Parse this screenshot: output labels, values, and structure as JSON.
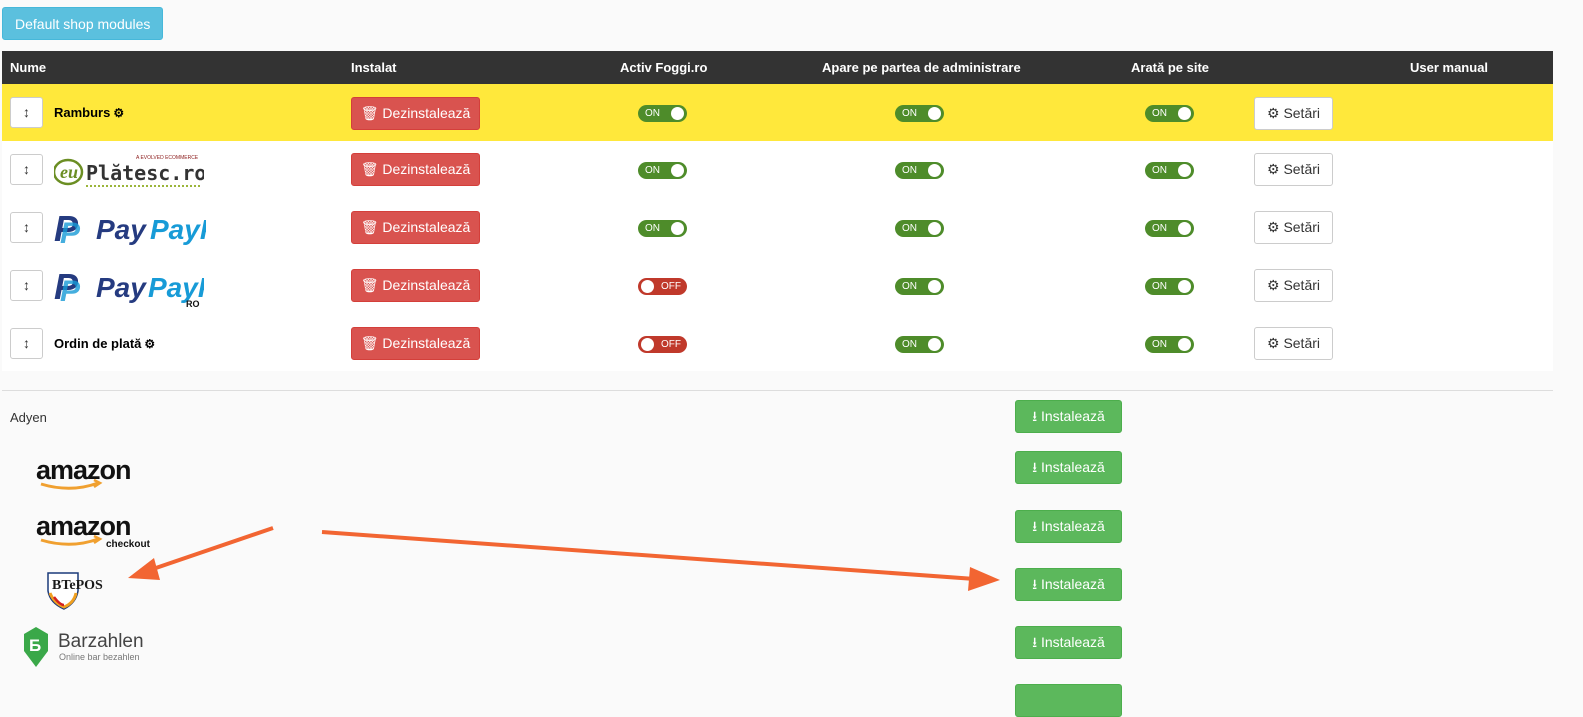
{
  "top_button": "Default shop modules",
  "headers": {
    "name": "Nume",
    "installed": "Instalat",
    "active": "Activ Foggi.ro",
    "admin": "Apare pe partea de administrare",
    "site": "Arată pe site",
    "manual": "User manual"
  },
  "installed_modules": [
    {
      "name": "Ramburs",
      "logo": "",
      "active": "ON",
      "admin": "ON",
      "site": "ON",
      "highlight": true
    },
    {
      "name": "",
      "logo": "euPlătesc.ro",
      "logo_tagline": "A EVOLVED ECOMMERCE",
      "active": "ON",
      "admin": "ON",
      "site": "ON"
    },
    {
      "name": "",
      "logo": "PayPal",
      "active": "ON",
      "admin": "ON",
      "site": "ON"
    },
    {
      "name": "",
      "logo": "PayPal",
      "logo_suffix": "RO",
      "active": "OFF",
      "admin": "ON",
      "site": "ON"
    },
    {
      "name": "Ordin de plată",
      "logo": "",
      "active": "OFF",
      "admin": "ON",
      "site": "ON"
    }
  ],
  "uninstall_label": "Dezinstalează",
  "settings_label": "Setări",
  "install_label": "Instalează",
  "available_modules": [
    {
      "name": "Adyen"
    },
    {
      "logo": "amazon"
    },
    {
      "logo": "amazon",
      "logo_suffix": "checkout"
    },
    {
      "logo": "BTePOS"
    },
    {
      "logo": "Barzahlen",
      "logo_tagline": "Online bar bezahlen"
    }
  ],
  "colors": {
    "toggle_on": "#4e8c2a",
    "toggle_off": "#c0392b",
    "highlight": "#ffe83b",
    "annotation_arrow": "#f26532"
  }
}
